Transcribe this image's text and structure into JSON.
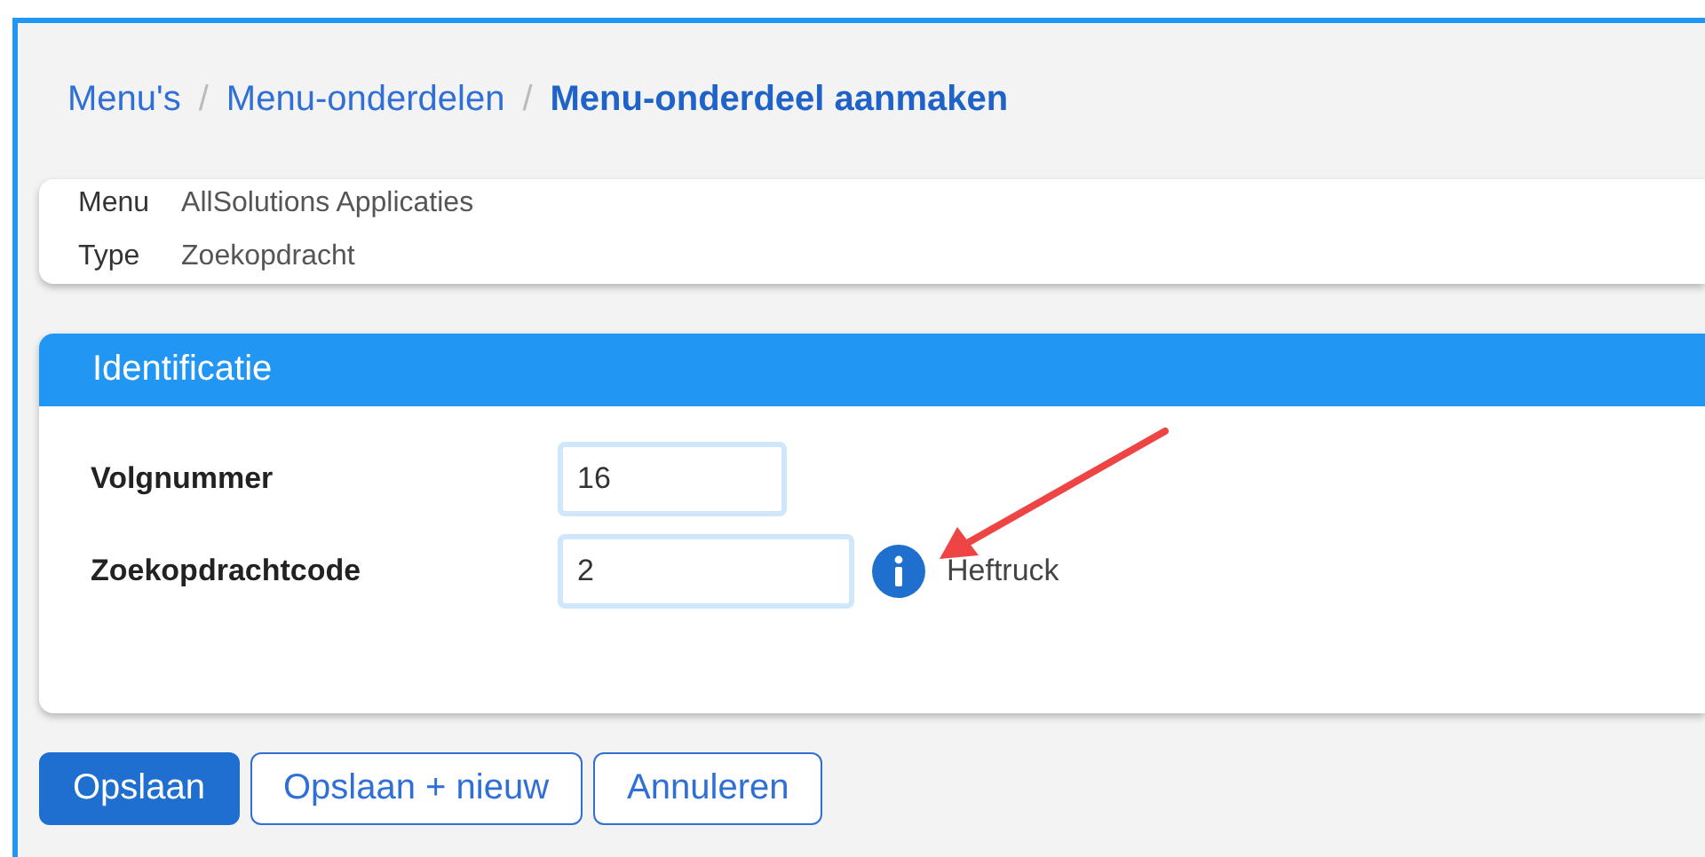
{
  "breadcrumb_separator": "/",
  "breadcrumb": [
    {
      "label": "Menu's",
      "current": false
    },
    {
      "label": "Menu-onderdelen",
      "current": false
    },
    {
      "label": "Menu-onderdeel aanmaken",
      "current": true
    }
  ],
  "summary": [
    {
      "label": "Menu",
      "value": "AllSolutions Applicaties"
    },
    {
      "label": "Type",
      "value": "Zoekopdracht"
    }
  ],
  "section": {
    "title": "Identificatie",
    "fields": [
      {
        "label": "Volgnummer",
        "value": "16",
        "kind": "short"
      },
      {
        "label": "Zoekopdrachtcode",
        "value": "2",
        "kind": "lookup",
        "description": "Heftruck"
      }
    ]
  },
  "buttons": [
    {
      "label": "Opslaan",
      "kind": "primary"
    },
    {
      "label": "Opslaan + nieuw",
      "kind": "secondary"
    },
    {
      "label": "Annuleren",
      "kind": "secondary"
    }
  ]
}
